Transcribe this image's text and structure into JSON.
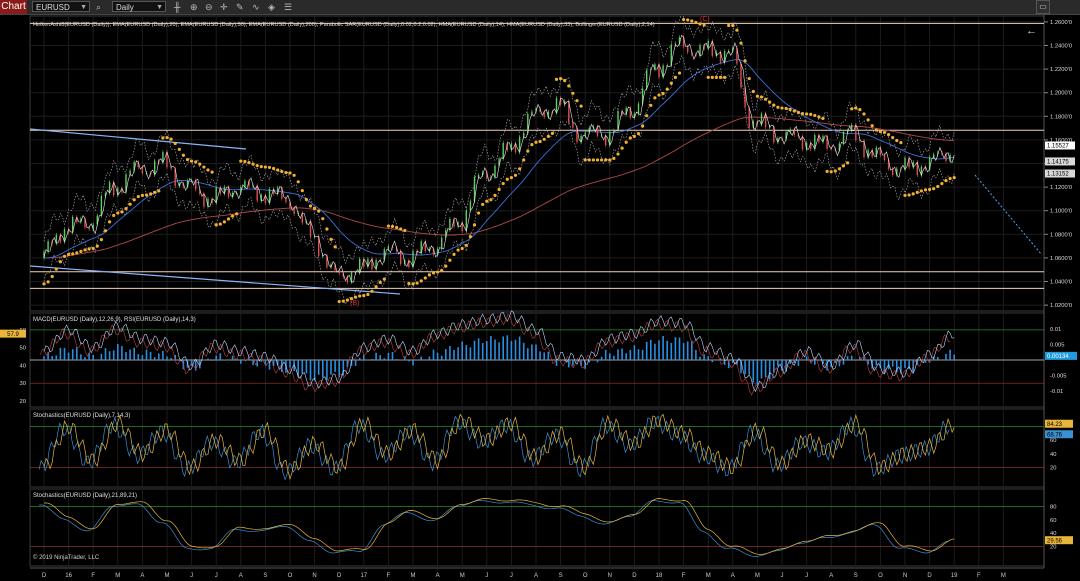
{
  "toolbar": {
    "tab_label": "Chart",
    "instrument": "EURUSD",
    "interval": "Daily"
  },
  "panels": {
    "price": {
      "title": "HeikenAshi8(EURUSD (Daily)), EMA(EURUSD (Daily),20), EMA(EURUSD (Daily),50), EMA(EURUSD (Daily),200), Parabolic SAR(EURUSD (Daily),0.02,0.2,0.02), HMA(EURUSD (Daily),14), HMA(EURUSD (Daily),33), Bollinger(EURUSD (Daily),2,14)",
      "wave_labels": [
        "(B)",
        "(C)"
      ],
      "axis_ticks": [
        "1.2600'0",
        "1.2400'0",
        "1.2200'0",
        "1.2000'0",
        "1.1800'0",
        "1.1600'0",
        "1.1400'0",
        "1.1200'0",
        "1.1000'0",
        "1.0800'0",
        "1.0600'0",
        "1.0400'0",
        "1.0200'0"
      ],
      "axis_range": [
        1.015,
        1.265
      ],
      "price_badges": [
        {
          "text": "1.15527",
          "value": 1.15527,
          "bg": "#ffffff",
          "fg": "#000000"
        },
        {
          "text": "1.14175",
          "value": 1.14175,
          "bg": "#d9d9d9",
          "fg": "#000000"
        },
        {
          "text": "1.13152",
          "value": 1.13152,
          "bg": "#d9d9d9",
          "fg": "#000000"
        }
      ],
      "horizontal_levels": [
        1.2588,
        1.1682,
        1.0483,
        1.0342
      ]
    },
    "macd_rsi": {
      "title": "MACD(EURUSD (Daily),12,26,9), RSI(EURUSD (Daily),14,3)",
      "left_ticks": [
        "60",
        "50",
        "40",
        "30",
        "20"
      ],
      "right_ticks": [
        "0.01",
        "0.005",
        "-0.005",
        "-0.01"
      ],
      "badges": [
        {
          "text": "57.9",
          "bg": "#e8b53a",
          "fg": "#000000"
        },
        {
          "text": "0.00134",
          "bg": "#1e9be0",
          "fg": "#ffffff"
        }
      ]
    },
    "stoch1": {
      "title": "Stochastics(EURUSD (Daily),7,14,3)",
      "right_ticks": [
        "60",
        "40",
        "20"
      ],
      "badges": [
        {
          "text": "84.23",
          "bg": "#e8b53a",
          "fg": "#000000"
        },
        {
          "text": "68.76",
          "bg": "#3a8fd0",
          "fg": "#000000"
        }
      ]
    },
    "stoch2": {
      "title": "Stochastics(EURUSD (Daily),21,89,21)",
      "right_ticks": [
        "80",
        "60",
        "40",
        "20"
      ],
      "badges": [
        {
          "text": "29.56",
          "bg": "#e8b53a",
          "fg": "#000000"
        }
      ],
      "copyright": "© 2019 NinjaTrader, LLC"
    }
  },
  "time_axis": [
    "D",
    "16",
    "F",
    "M",
    "A",
    "M",
    "J",
    "J",
    "A",
    "S",
    "O",
    "N",
    "D",
    "17",
    "F",
    "M",
    "A",
    "M",
    "J",
    "J",
    "A",
    "S",
    "O",
    "N",
    "D",
    "18",
    "F",
    "M",
    "A",
    "M",
    "J",
    "J",
    "A",
    "S",
    "O",
    "N",
    "D",
    "19",
    "F",
    "M"
  ],
  "chart_data": {
    "type": "line",
    "title": "",
    "x": [
      "D",
      "16",
      "F",
      "M",
      "A",
      "M",
      "J",
      "J",
      "A",
      "S",
      "O",
      "N",
      "D",
      "17",
      "F",
      "M",
      "A",
      "M",
      "J",
      "J",
      "A",
      "S",
      "O",
      "N",
      "D",
      "18",
      "F",
      "M",
      "A",
      "M",
      "J",
      "J",
      "A",
      "S",
      "O",
      "N",
      "D",
      "19"
    ],
    "ylim": [
      1.015,
      1.265
    ],
    "series": [
      {
        "values": [
          1.06,
          1.085,
          1.09,
          1.12,
          1.135,
          1.14,
          1.12,
          1.11,
          1.12,
          1.115,
          1.11,
          1.08,
          1.045,
          1.05,
          1.065,
          1.06,
          1.07,
          1.09,
          1.13,
          1.15,
          1.18,
          1.19,
          1.165,
          1.165,
          1.185,
          1.22,
          1.24,
          1.235,
          1.235,
          1.175,
          1.165,
          1.16,
          1.155,
          1.165,
          1.145,
          1.135,
          1.14,
          1.15
        ]
      }
    ],
    "macd": [
      0.002,
      0.006,
      0.002,
      0.007,
      0.004,
      0.003,
      -0.005,
      0.002,
      0.0,
      -0.003,
      -0.006,
      -0.01,
      -0.008,
      0.001,
      0.003,
      -0.001,
      0.004,
      0.008,
      0.011,
      0.012,
      0.007,
      -0.002,
      -0.003,
      0.004,
      0.006,
      0.011,
      0.011,
      0.001,
      -0.003,
      -0.012,
      -0.005,
      0.0,
      -0.004,
      0.002,
      -0.005,
      -0.006,
      0.0,
      0.004
    ],
    "rsi": [
      48,
      60,
      50,
      62,
      55,
      53,
      40,
      52,
      48,
      45,
      38,
      30,
      33,
      50,
      55,
      48,
      58,
      63,
      66,
      68,
      60,
      45,
      43,
      55,
      58,
      65,
      64,
      50,
      44,
      28,
      38,
      48,
      40,
      52,
      38,
      36,
      46,
      58
    ],
    "stoch_fast": [
      20,
      80,
      30,
      85,
      40,
      75,
      20,
      60,
      30,
      75,
      15,
      55,
      20,
      85,
      40,
      75,
      30,
      90,
      60,
      85,
      35,
      70,
      20,
      85,
      55,
      90,
      70,
      40,
      20,
      75,
      25,
      60,
      45,
      85,
      20,
      40,
      50,
      84
    ],
    "stoch_slow": [
      85,
      65,
      45,
      85,
      85,
      60,
      20,
      20,
      50,
      45,
      55,
      30,
      15,
      15,
      55,
      75,
      60,
      85,
      90,
      90,
      85,
      80,
      70,
      55,
      70,
      90,
      90,
      45,
      20,
      10,
      15,
      30,
      35,
      45,
      55,
      20,
      15,
      29.56
    ]
  }
}
